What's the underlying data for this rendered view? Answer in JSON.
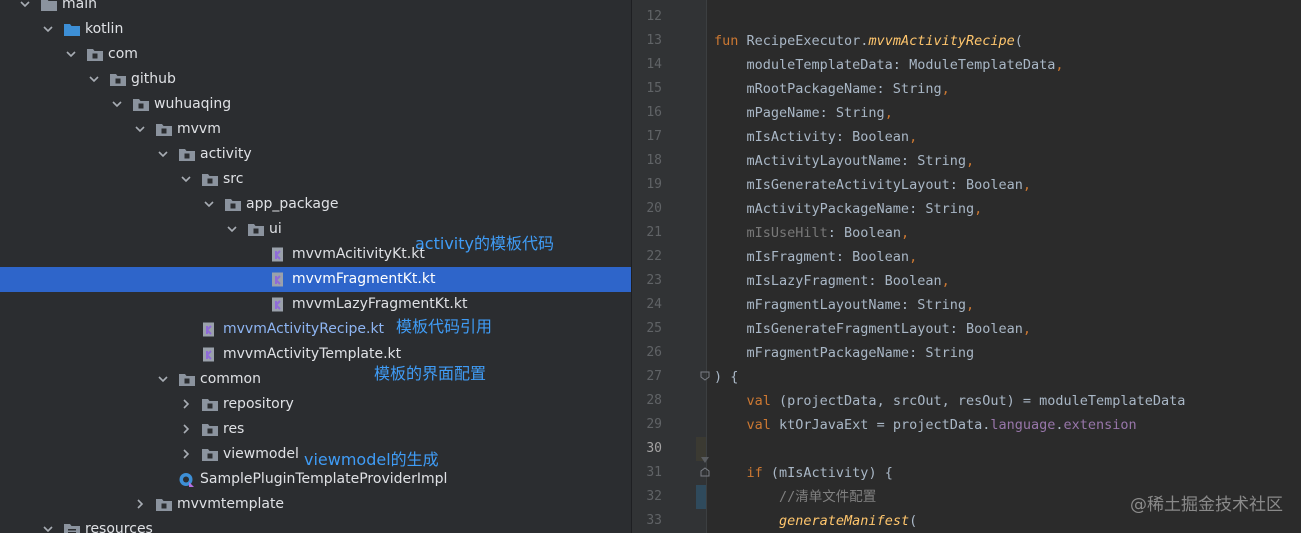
{
  "project_tree": {
    "rows": [
      {
        "label": "main",
        "icon": "folder-icon",
        "expanded": true
      },
      {
        "label": "kotlin",
        "icon": "source-folder-icon",
        "expanded": true
      },
      {
        "label": "com",
        "icon": "package-folder-icon",
        "expanded": true
      },
      {
        "label": "github",
        "icon": "package-folder-icon",
        "expanded": true
      },
      {
        "label": "wuhuaqing",
        "icon": "package-folder-icon",
        "expanded": true
      },
      {
        "label": "mvvm",
        "icon": "package-folder-icon",
        "expanded": true
      },
      {
        "label": "activity",
        "icon": "package-folder-icon",
        "expanded": true
      },
      {
        "label": "src",
        "icon": "package-folder-icon",
        "expanded": true
      },
      {
        "label": "app_package",
        "icon": "package-folder-icon",
        "expanded": true
      },
      {
        "label": "ui",
        "icon": "package-folder-icon",
        "expanded": true
      },
      {
        "label": "mvvmAcitivityKt.kt",
        "icon": "kotlin-file-icon"
      },
      {
        "label": "mvvmFragmentKt.kt",
        "icon": "kotlin-file-icon",
        "selected": true
      },
      {
        "label": "mvvmLazyFragmentKt.kt",
        "icon": "kotlin-file-icon"
      },
      {
        "label": "mvvmActivityRecipe.kt",
        "icon": "kotlin-file-icon",
        "modified": true
      },
      {
        "label": "mvvmActivityTemplate.kt",
        "icon": "kotlin-file-icon"
      },
      {
        "label": "common",
        "icon": "package-folder-icon",
        "expanded": true
      },
      {
        "label": "repository",
        "icon": "package-folder-icon",
        "expanded": false
      },
      {
        "label": "res",
        "icon": "package-folder-icon",
        "expanded": false
      },
      {
        "label": "viewmodel",
        "icon": "package-folder-icon",
        "expanded": false
      },
      {
        "label": "SamplePluginTemplateProviderImpl",
        "icon": "kotlin-class-icon"
      },
      {
        "label": "mvvmtemplate",
        "icon": "package-folder-icon",
        "expanded": false
      },
      {
        "label": "resources",
        "icon": "resources-folder-icon",
        "expanded": true
      }
    ]
  },
  "annotations": {
    "activity_template": "activity的模板代码",
    "template_ref": "模板代码引用",
    "template_ui": "模板的界面配置",
    "viewmodel_gen": "viewmodel的生成"
  },
  "editor": {
    "line_numbers": [
      "12",
      "13",
      "14",
      "15",
      "16",
      "17",
      "18",
      "19",
      "20",
      "21",
      "22",
      "23",
      "24",
      "25",
      "26",
      "27",
      "28",
      "29",
      "30",
      "31",
      "32",
      "33"
    ],
    "current_line": "30",
    "code": {
      "l13_kw": "fun ",
      "l13_recv": "RecipeExecutor.",
      "l13_fn": "mvvmActivityRecipe",
      "l13_paren": "(",
      "l14": "    moduleTemplateData: ModuleTemplateData",
      "l15": "    mRootPackageName: String",
      "l16": "    mPageName: String",
      "l17": "    mIsActivity: Boolean",
      "l18": "    mActivityLayoutName: String",
      "l19": "    mIsGenerateActivityLayout: Boolean",
      "l20": "    mActivityPackageName: String",
      "l21_name": "    mIsUseHilt",
      "l21_rest": ": Boolean",
      "l22": "    mIsFragment: Boolean",
      "l23": "    mIsLazyFragment: Boolean",
      "l24": "    mFragmentLayoutName: String",
      "l25": "    mIsGenerateFragmentLayout: Boolean",
      "l26": "    mFragmentPackageName: String",
      "l27": ") {",
      "comma": ",",
      "val_kw": "    val ",
      "l28_rest": "(projectData, srcOut, resOut) = moduleTemplateData",
      "l29_a": "ktOrJavaExt = projectData.",
      "l29_p1": "language",
      "l29_dot": ".",
      "l29_p2": "extension",
      "l31_if": "    if ",
      "l31_rest": "(mIsActivity) {",
      "l32": "        //清单文件配置",
      "l33_indent": "        ",
      "l33_fn": "generateManifest",
      "l33_paren": "("
    }
  },
  "watermark": "@稀土掘金技术社区",
  "colors": {
    "selection": "#2e65ca",
    "annotation": "#3f9cf6",
    "keyword": "#cc7832",
    "function": "#ffc66d",
    "property": "#9876aa"
  }
}
